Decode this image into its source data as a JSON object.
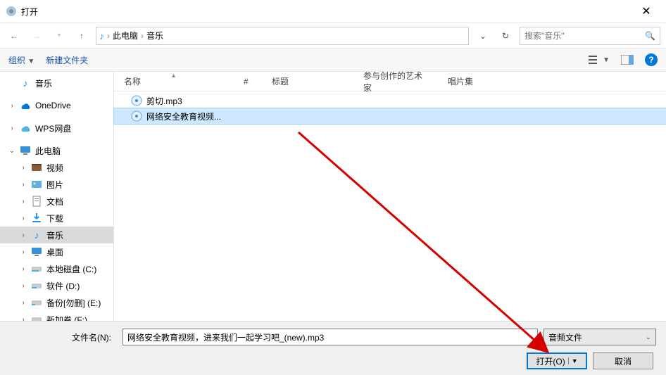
{
  "window": {
    "title": "打开"
  },
  "nav": {
    "path": {
      "icon": "music",
      "seg1": "此电脑",
      "seg2": "音乐"
    },
    "search_placeholder": "搜索\"音乐\""
  },
  "toolbar": {
    "organize": "组织",
    "newfolder": "新建文件夹"
  },
  "sidebar": {
    "items": [
      {
        "label": "音乐",
        "icon": "music",
        "indent": "child"
      },
      {
        "label": "OneDrive",
        "icon": "onedrive"
      },
      {
        "label": "WPS网盘",
        "icon": "wps"
      },
      {
        "label": "此电脑",
        "icon": "pc",
        "expandable": true
      },
      {
        "label": "视频",
        "icon": "video",
        "indent": "child"
      },
      {
        "label": "图片",
        "icon": "pictures",
        "indent": "child"
      },
      {
        "label": "文档",
        "icon": "docs",
        "indent": "child"
      },
      {
        "label": "下载",
        "icon": "downloads",
        "indent": "child"
      },
      {
        "label": "音乐",
        "icon": "music",
        "indent": "child",
        "selected": true
      },
      {
        "label": "桌面",
        "icon": "desktop",
        "indent": "child"
      },
      {
        "label": "本地磁盘 (C:)",
        "icon": "disk",
        "indent": "child"
      },
      {
        "label": "软件 (D:)",
        "icon": "disk",
        "indent": "child"
      },
      {
        "label": "备份[勿删] (E:)",
        "icon": "disk",
        "indent": "child"
      },
      {
        "label": "新加卷 (F:)",
        "icon": "disk",
        "indent": "child"
      }
    ]
  },
  "columns": {
    "name": "名称",
    "num": "#",
    "title": "标题",
    "artist": "参与创作的艺术家",
    "album": "唱片集"
  },
  "files": [
    {
      "name": "剪切.mp3",
      "selected": false
    },
    {
      "name": "网络安全教育视频...",
      "selected": true
    }
  ],
  "footer": {
    "filename_label": "文件名(N):",
    "filename_value": "网络安全教育视频，进来我们一起学习吧_(new).mp3",
    "filetype": "音频文件",
    "open": "打开(O)",
    "cancel": "取消"
  }
}
